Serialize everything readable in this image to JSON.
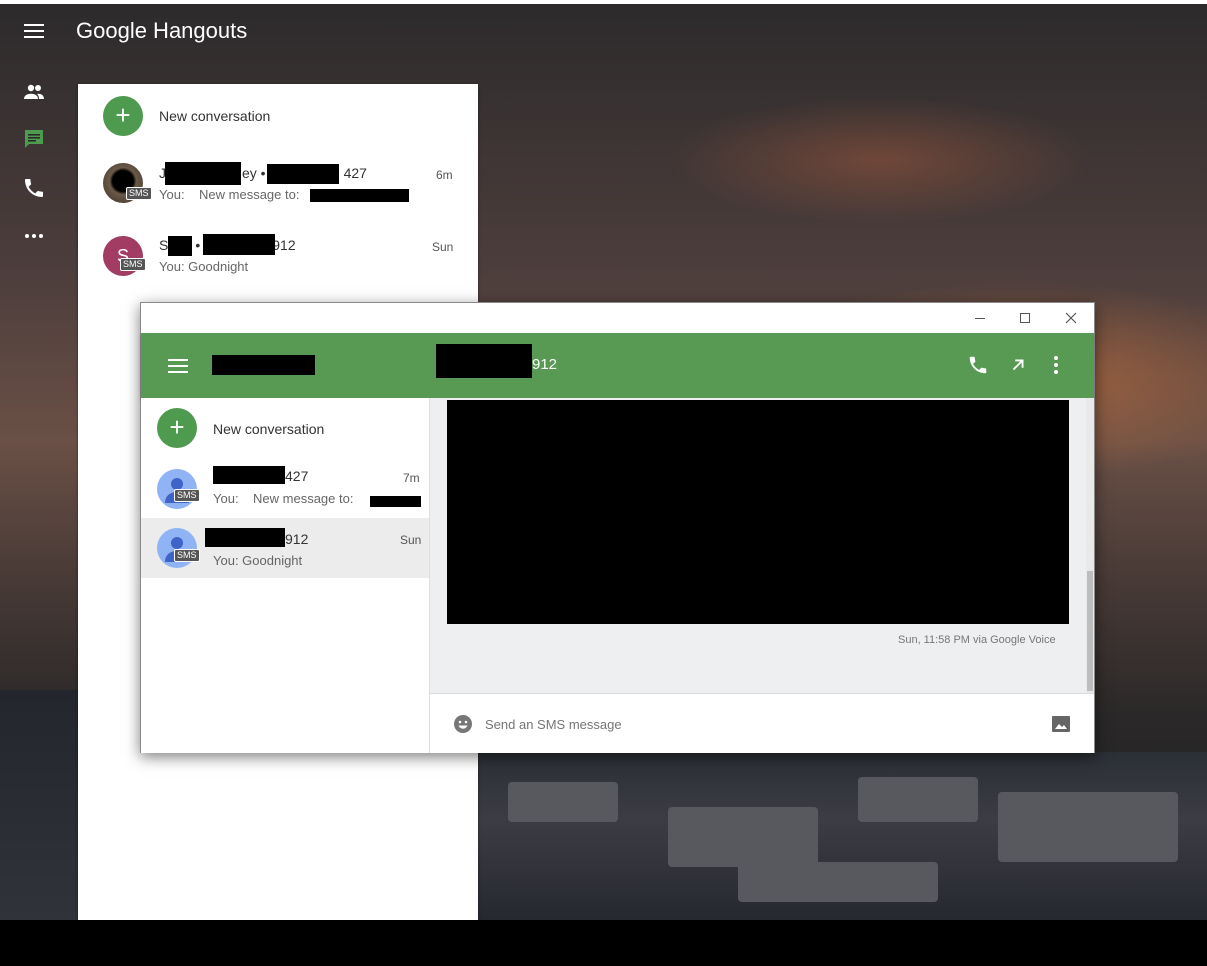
{
  "app": {
    "brand": "Google Hangouts"
  },
  "rail": {
    "icons": [
      "people-icon",
      "chat-icon",
      "phone-icon",
      "more-horiz-icon"
    ]
  },
  "list": {
    "new_conversation": "New conversation",
    "conversations": [
      {
        "title_start": "J",
        "title_mid": "ey •",
        "title_end": "427",
        "you": "You:",
        "snippet": "New message to:",
        "time": "6m",
        "badge": "SMS"
      },
      {
        "title_start": "S",
        "title_mid": "•",
        "title_end": "912",
        "snippet": "You: Goodnight",
        "time": "Sun",
        "avatar_letter": "S",
        "badge": "SMS"
      }
    ]
  },
  "window": {
    "header_title_end": "912",
    "inner_list": {
      "new_conversation": "New conversation",
      "conversations": [
        {
          "title_end": "427",
          "you": "You:",
          "snippet": "New message to:",
          "time": "7m",
          "badge": "SMS"
        },
        {
          "title_end": "912",
          "snippet": "You: Goodnight",
          "time": "Sun",
          "badge": "SMS"
        }
      ]
    },
    "message_meta": "Sun, 11:58 PM  via Google Voice",
    "composer": {
      "placeholder": "Send an SMS message"
    }
  },
  "colors": {
    "accent_green": "#589a54",
    "avatar_pink": "#a23c62",
    "avatar_blue": "#8fb3f5"
  }
}
